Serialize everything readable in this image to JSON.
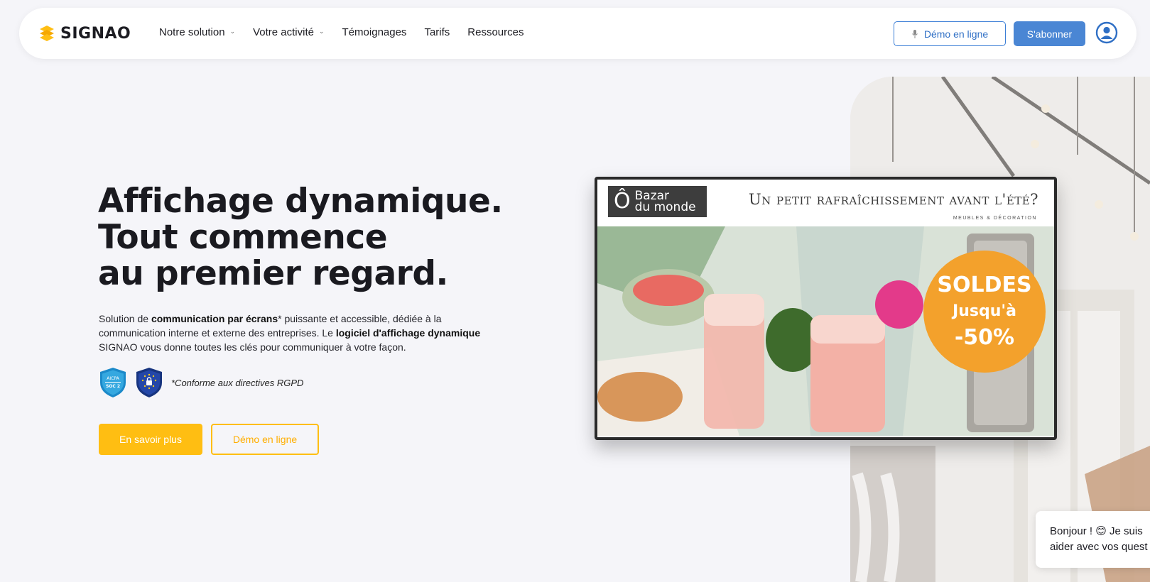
{
  "nav": {
    "logo_text": "SIGNAO",
    "links": [
      {
        "label": "Notre solution",
        "dropdown": true
      },
      {
        "label": "Votre activité",
        "dropdown": true
      },
      {
        "label": "Témoignages",
        "dropdown": false
      },
      {
        "label": "Tarifs",
        "dropdown": false
      },
      {
        "label": "Ressources",
        "dropdown": false
      }
    ],
    "demo_label": "Démo en ligne",
    "subscribe_label": "S'abonner"
  },
  "hero": {
    "title_lines": [
      "Affichage dynamique.",
      "Tout commence",
      "au premier regard."
    ],
    "desc": {
      "p1": "Solution de ",
      "b1": "communication par écrans",
      "p2": "* puissante et accessible, dédiée à la communication interne et externe des entreprises. Le ",
      "b2": "logiciel d'affichage dynamique",
      "p3": " SIGNAO vous donne toutes les clés pour communiquer à votre façon."
    },
    "badge_soc_line1": "AICPA",
    "badge_soc_line2": "SOC 2",
    "rgpd_note": "*Conforme aux directives RGPD",
    "primary_label": "En savoir plus",
    "secondary_label": "Démo en ligne"
  },
  "ad": {
    "brand_line1": "Bazar",
    "brand_line2": "du monde",
    "slogan": "Un petit rafraîchissement avant l'été?",
    "subline": "MEUBLES & DÉCORATION",
    "promo_line1": "SOLDES",
    "promo_line2": "Jusqu'à",
    "promo_line3": "-50%"
  },
  "chat": {
    "line1": "Bonjour ! 😊 Je suis",
    "line2": "aider avec vos quest"
  },
  "colors": {
    "accent_yellow": "#ffbe12",
    "accent_blue": "#4a86d4",
    "background": "#f5f5f9"
  }
}
